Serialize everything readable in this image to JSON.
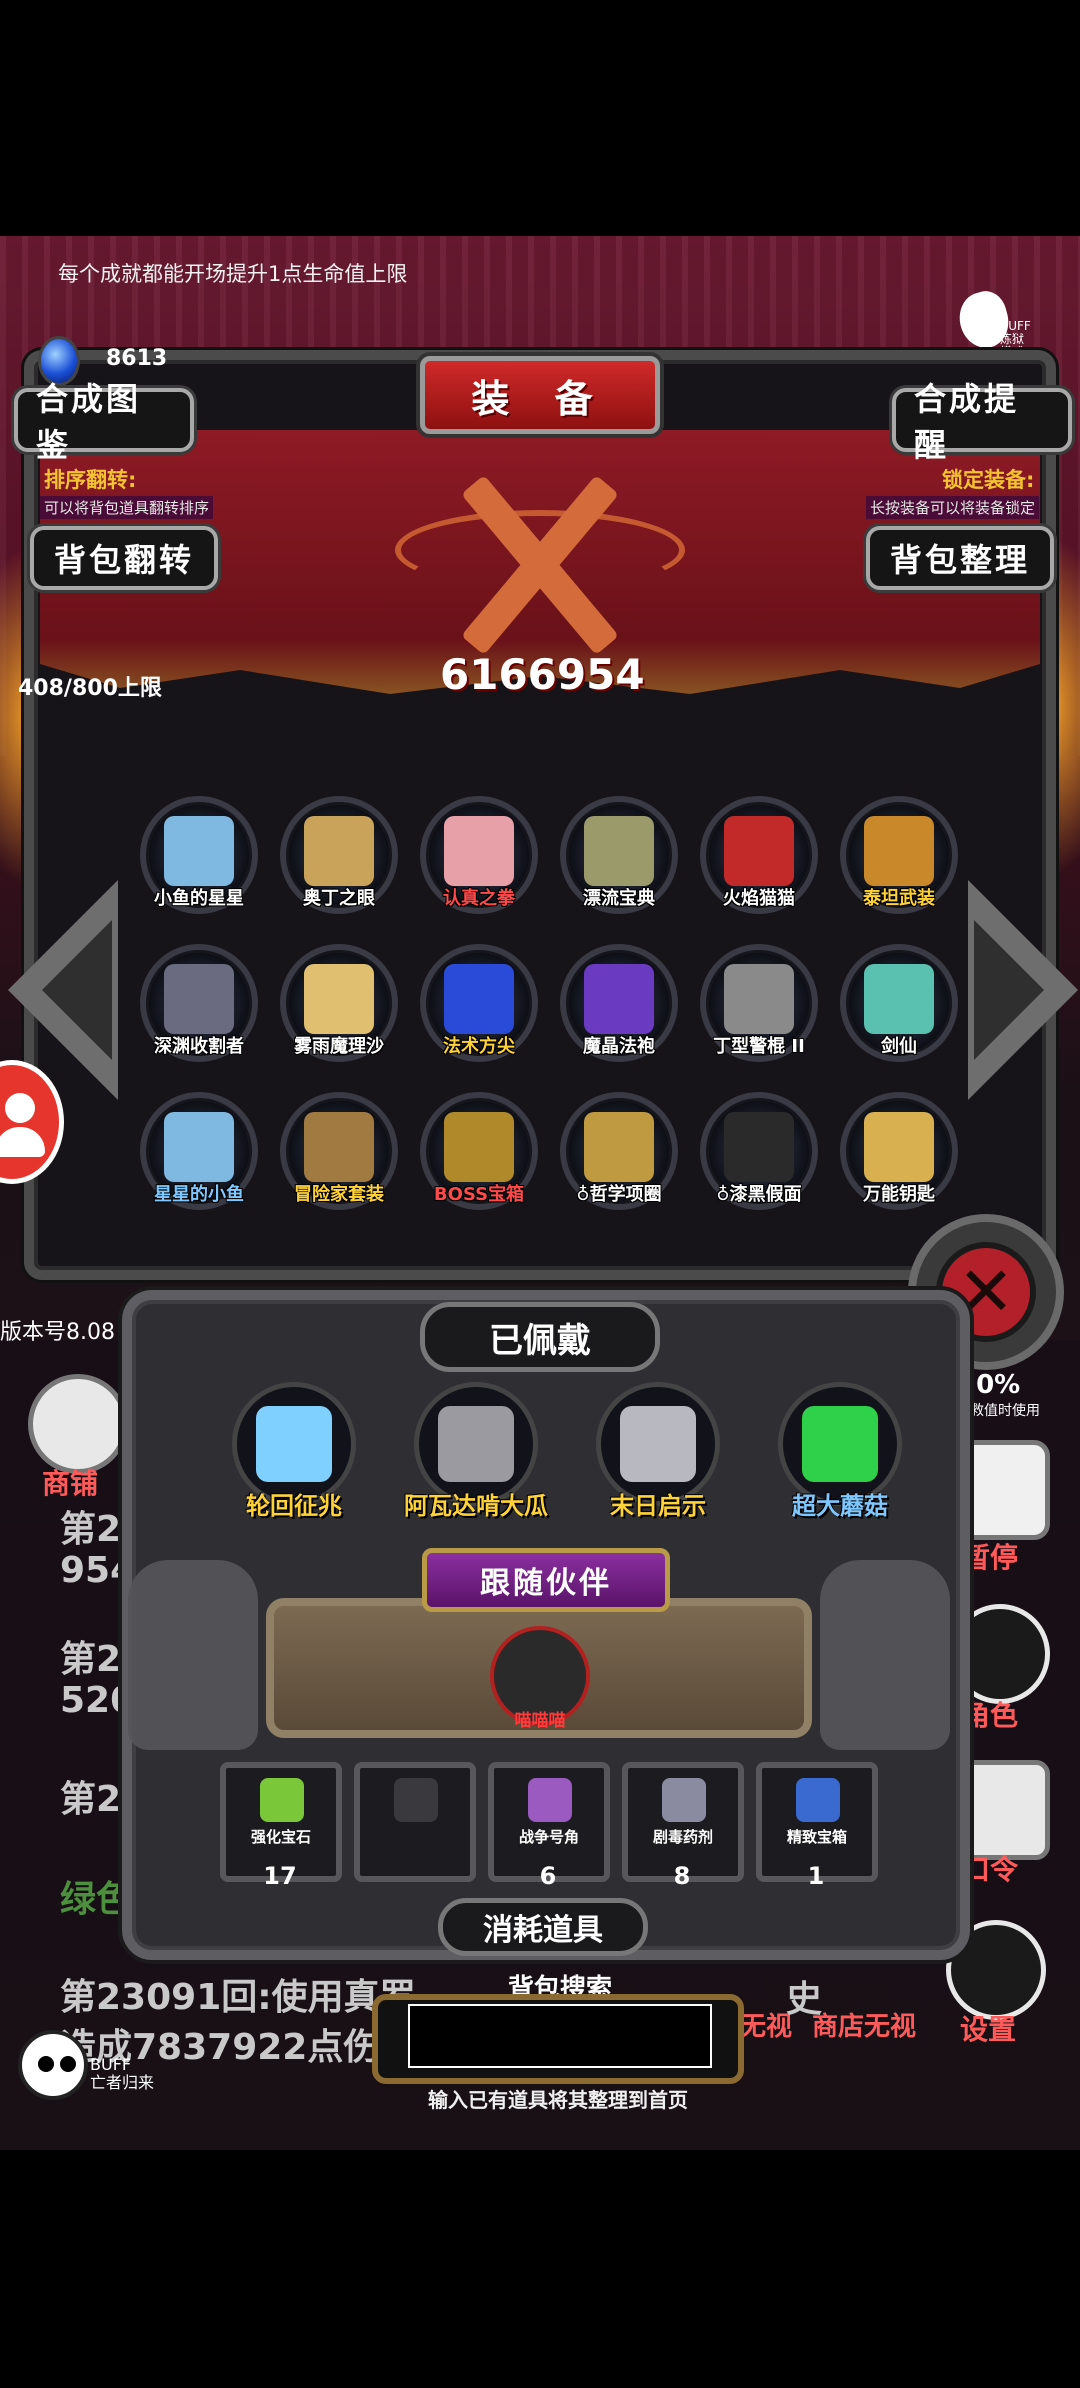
{
  "hint_text": "每个成就都能开场提升1点生命值上限",
  "buff_logo": {
    "label_top": "BUFF",
    "label_bottom": "炼狱模式"
  },
  "currency": {
    "icon": "blue-crystal-icon",
    "value": "8613"
  },
  "title": "装 备",
  "buttons": {
    "synthesis_book": "合成图鉴",
    "synthesis_reminder": "合成提醒",
    "bag_flip": "背包翻转",
    "bag_sort": "背包整理"
  },
  "sort_flip": {
    "title": "排序翻转:",
    "desc": "可以将背包道具翻转排序"
  },
  "lock_equip": {
    "title": "锁定装备:",
    "desc": "长按装备可以将装备锁定"
  },
  "capacity": "408/800上限",
  "score": "6166954",
  "items": [
    {
      "name": "小鱼的星星",
      "icon": "star-wand-icon",
      "color": "#7fb8e0"
    },
    {
      "name": "奥丁之眼",
      "icon": "eye-staff-icon",
      "color": "#c9a35a"
    },
    {
      "name": "认真之拳",
      "icon": "fist-icon",
      "color": "#e8a0a8",
      "name_color": "#ff4a4a"
    },
    {
      "name": "漂流宝典",
      "icon": "book-icon",
      "color": "#9a9a6a"
    },
    {
      "name": "火焰猫猫",
      "icon": "cat-girl-icon",
      "color": "#c22a2a"
    },
    {
      "name": "泰坦武装",
      "icon": "titan-armor-icon",
      "color": "#c9882a",
      "name_color": "#ffd23a"
    },
    {
      "name": "深渊收割者",
      "icon": "scythe-icon",
      "color": "#6a6a80"
    },
    {
      "name": "雾雨魔理沙",
      "icon": "witch-icon",
      "color": "#e0c070"
    },
    {
      "name": "法术方尖",
      "icon": "obelisk-icon",
      "color": "#2a4ad8",
      "name_color": "#ffd23a"
    },
    {
      "name": "魔晶法袍",
      "icon": "mage-robe-icon",
      "color": "#6a3ac0"
    },
    {
      "name": "丁型警棍 II",
      "icon": "baton-icon",
      "color": "#8a8a8a"
    },
    {
      "name": "剑仙",
      "icon": "sword-master-icon",
      "color": "#5ac0b0"
    },
    {
      "name": "星星的小鱼",
      "icon": "star-fish-wand-icon",
      "color": "#7fb8e0",
      "name_color": "#7fc8ff"
    },
    {
      "name": "冒险家套装",
      "icon": "explorer-icon",
      "color": "#a07a40",
      "name_color": "#ffd23a"
    },
    {
      "name": "BOSS宝箱",
      "icon": "chest-icon",
      "color": "#b08a2a",
      "name_color": "#ff4a4a"
    },
    {
      "name": "哲学项圈",
      "icon": "collar-icon",
      "color": "#c09a40",
      "prefix": "♁"
    },
    {
      "name": "漆黑假面",
      "icon": "mask-icon",
      "color": "#2a2a2a",
      "prefix": "♁"
    },
    {
      "name": "万能钥匙",
      "icon": "key-icon",
      "color": "#d8b050"
    }
  ],
  "version": "版本号8.08",
  "equipped": {
    "title": "已佩戴",
    "items": [
      {
        "name": "轮回征兆",
        "icon": "ice-staff-icon",
        "color": "#7fd0ff",
        "name_color": "#ffd23a"
      },
      {
        "name": "阿瓦达啃大瓜",
        "icon": "dark-staff-icon",
        "color": "#9a9aa0",
        "name_color": "#ffd23a"
      },
      {
        "name": "末日启示",
        "icon": "axe-icon",
        "color": "#b8b8c0",
        "name_color": "#ffd23a"
      },
      {
        "name": "超大蘑菇",
        "icon": "mushroom-icon",
        "color": "#2fd04a",
        "name_color": "#7fc8ff"
      }
    ]
  },
  "companion": {
    "title": "跟随伙伴",
    "name": "喵喵喵",
    "icon": "knight-cat-icon"
  },
  "consumables": {
    "title": "消耗道具",
    "items": [
      {
        "name": "强化宝石",
        "count": "17",
        "icon": "green-gem-icon",
        "color": "#7ac83a"
      },
      {
        "name": "",
        "count": "",
        "icon": "empty-slot-icon",
        "color": "#3a3a3e"
      },
      {
        "name": "战争号角",
        "count": "6",
        "icon": "horn-icon",
        "color": "#9a5ac0"
      },
      {
        "name": "剧毒药剂",
        "count": "8",
        "icon": "potion-icon",
        "color": "#8a8aa0"
      },
      {
        "name": "精致宝箱",
        "count": "1",
        "icon": "fine-chest-icon",
        "color": "#3a6ad0"
      }
    ]
  },
  "search": {
    "label": "背包搜索",
    "placeholder": "",
    "hint": "输入已有道具将其整理到首页"
  },
  "side_menu": {
    "shop": "商铺",
    "pause": "暂停",
    "role": "角色",
    "code": "口令",
    "settings": "设置",
    "reading_top": "30%",
    "reading_desc": "真救值时使用"
  },
  "background_log": {
    "line1a": "第2",
    "line1b": "954",
    "line2a": "第23",
    "line2b": "520",
    "line3": "第23",
    "line4": "绿色",
    "line5": "第23091回:使用真罗",
    "line6": "造成7837922点伤",
    "tail1": "无视",
    "tail2": "商店无视",
    "tail3": "史",
    "right_fragment": "7"
  },
  "bottom_logo": {
    "label_top": "BUFF",
    "label_bottom": "亡者归来"
  }
}
